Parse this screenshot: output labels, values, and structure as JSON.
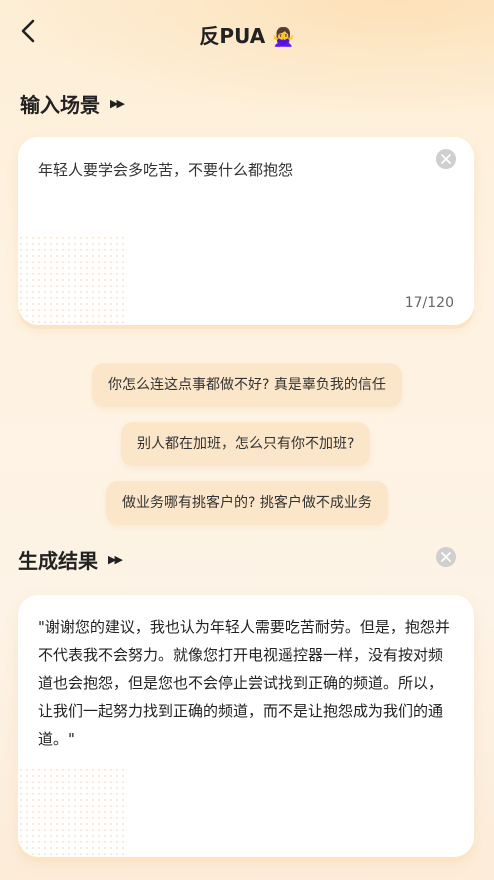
{
  "header": {
    "title": "反PUA",
    "title_emoji": "🙅‍♀️"
  },
  "input_section": {
    "title": "输入场景",
    "text": "年轻人要学会多吃苦，不要什么都抱怨",
    "counter": "17/120"
  },
  "suggestions": [
    "你怎么连这点事都做不好? 真是辜负我的信任",
    "别人都在加班，怎么只有你不加班?",
    "做业务哪有挑客户的? 挑客户做不成业务"
  ],
  "result_section": {
    "title": "生成结果",
    "text": "\"谢谢您的建议，我也认为年轻人需要吃苦耐劳。但是，抱怨并不代表我不会努力。就像您打开电视遥控器一样，没有按对频道也会抱怨，但是您也不会停止尝试找到正确的频道。所以，让我们一起努力找到正确的频道，而不是让抱怨成为我们的通道。\""
  },
  "icons": {
    "back": "chevron-left-icon",
    "clear": "clear-circle-icon",
    "section_arrows": "double-play-icon"
  },
  "colors": {
    "chip_bg": "#fbe6c9",
    "card_bg": "#ffffff",
    "page_bg": "#fdf0dd"
  }
}
